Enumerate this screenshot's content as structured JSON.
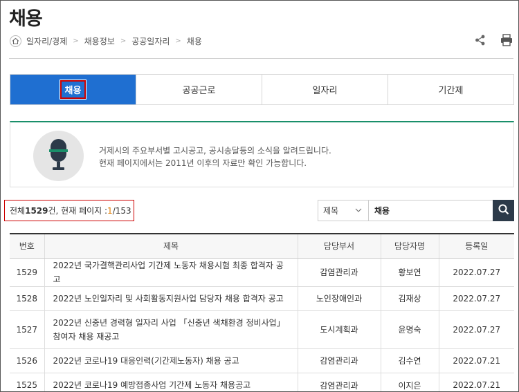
{
  "page": {
    "title": "채용"
  },
  "breadcrumb": {
    "items": [
      "일자리/경제",
      "채용정보",
      "공공일자리",
      "채용"
    ]
  },
  "tabs": [
    {
      "label": "채용",
      "active": true
    },
    {
      "label": "공공근로",
      "active": false
    },
    {
      "label": "일자리",
      "active": false
    },
    {
      "label": "기간제",
      "active": false
    }
  ],
  "info": {
    "line1": "거제시의 주요부서별 고시공고, 공시송달등의 소식을 알려드립니다.",
    "line2": "현재 페이지에서는 2011년 이후의 자료만 확인 가능합니다."
  },
  "summary": {
    "total_prefix": "전체 ",
    "total": "1529",
    "total_suffix": "건, 현재 페이지 : ",
    "current": "1",
    "pages": "/153"
  },
  "search": {
    "field": "제목",
    "value": "채용"
  },
  "table": {
    "headers": [
      "번호",
      "제목",
      "담당부서",
      "담당자명",
      "등록일"
    ],
    "rows": [
      {
        "no": "1529",
        "title": "2022년 국가결핵관리사업 기간제 노동자 채용시험 최종 합격자 공고",
        "dept": "감염관리과",
        "person": "황보연",
        "date": "2022.07.27"
      },
      {
        "no": "1528",
        "title": "2022년 노인일자리 및 사회활동지원사업 담당자 채용 합격자 공고",
        "dept": "노인장애인과",
        "person": "김재상",
        "date": "2022.07.27"
      },
      {
        "no": "1527",
        "title": "2022년 신중년 경력형 일자리 사업 「신중년 색채환경 정비사업」참여자 채용 재공고",
        "dept": "도시계획과",
        "person": "윤명숙",
        "date": "2022.07.27"
      },
      {
        "no": "1526",
        "title": "2022년 코로나19 대응인력(기간제노동자) 채용 공고",
        "dept": "감염관리과",
        "person": "김수연",
        "date": "2022.07.21"
      },
      {
        "no": "1525",
        "title": "2022년 코로나19 예방접종사업 기간제 노동자 채용공고",
        "dept": "감염관리과",
        "person": "이지은",
        "date": "2022.07.21"
      }
    ]
  },
  "icons": {
    "home": "home-icon",
    "share": "share-icon",
    "print": "print-icon",
    "mic": "microphone-icon",
    "search": "search-icon",
    "chevron": "chevron-down-icon"
  },
  "colors": {
    "tab_active": "#1f6fd1",
    "highlight_border": "#cc0000",
    "accent_line": "#1a8f6a",
    "mic_band": "#1a8f6a",
    "mic_body": "#2c3a49",
    "current_page": "#e07b00",
    "search_button": "#2c3a49"
  }
}
